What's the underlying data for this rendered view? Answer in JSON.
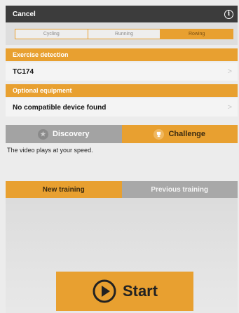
{
  "header": {
    "cancel_label": "Cancel",
    "info_glyph": "i"
  },
  "segments": [
    {
      "label": "Cycling",
      "active": false
    },
    {
      "label": "Running",
      "active": false
    },
    {
      "label": "Rowing",
      "active": true
    }
  ],
  "exercise_detection": {
    "header": "Exercise detection",
    "value": "TC174",
    "chevron": ">"
  },
  "optional_equipment": {
    "header": "Optional equipment",
    "value": "No compatible device found",
    "chevron": ">"
  },
  "mode_tabs": {
    "discovery": {
      "label": "Discovery",
      "icon": "star-icon",
      "glyph": "★"
    },
    "challenge": {
      "label": "Challenge",
      "icon": "trophy-icon",
      "glyph": "🏆"
    }
  },
  "description": "The video plays at your speed.",
  "training_tabs": {
    "new_label": "New training",
    "previous_label": "Previous training"
  },
  "start_button": {
    "label": "Start",
    "icon": "play-circle-icon"
  },
  "colors": {
    "accent": "#e8a030",
    "header_bg": "#3c3c3c",
    "inactive_tab": "#a3a3a3"
  }
}
